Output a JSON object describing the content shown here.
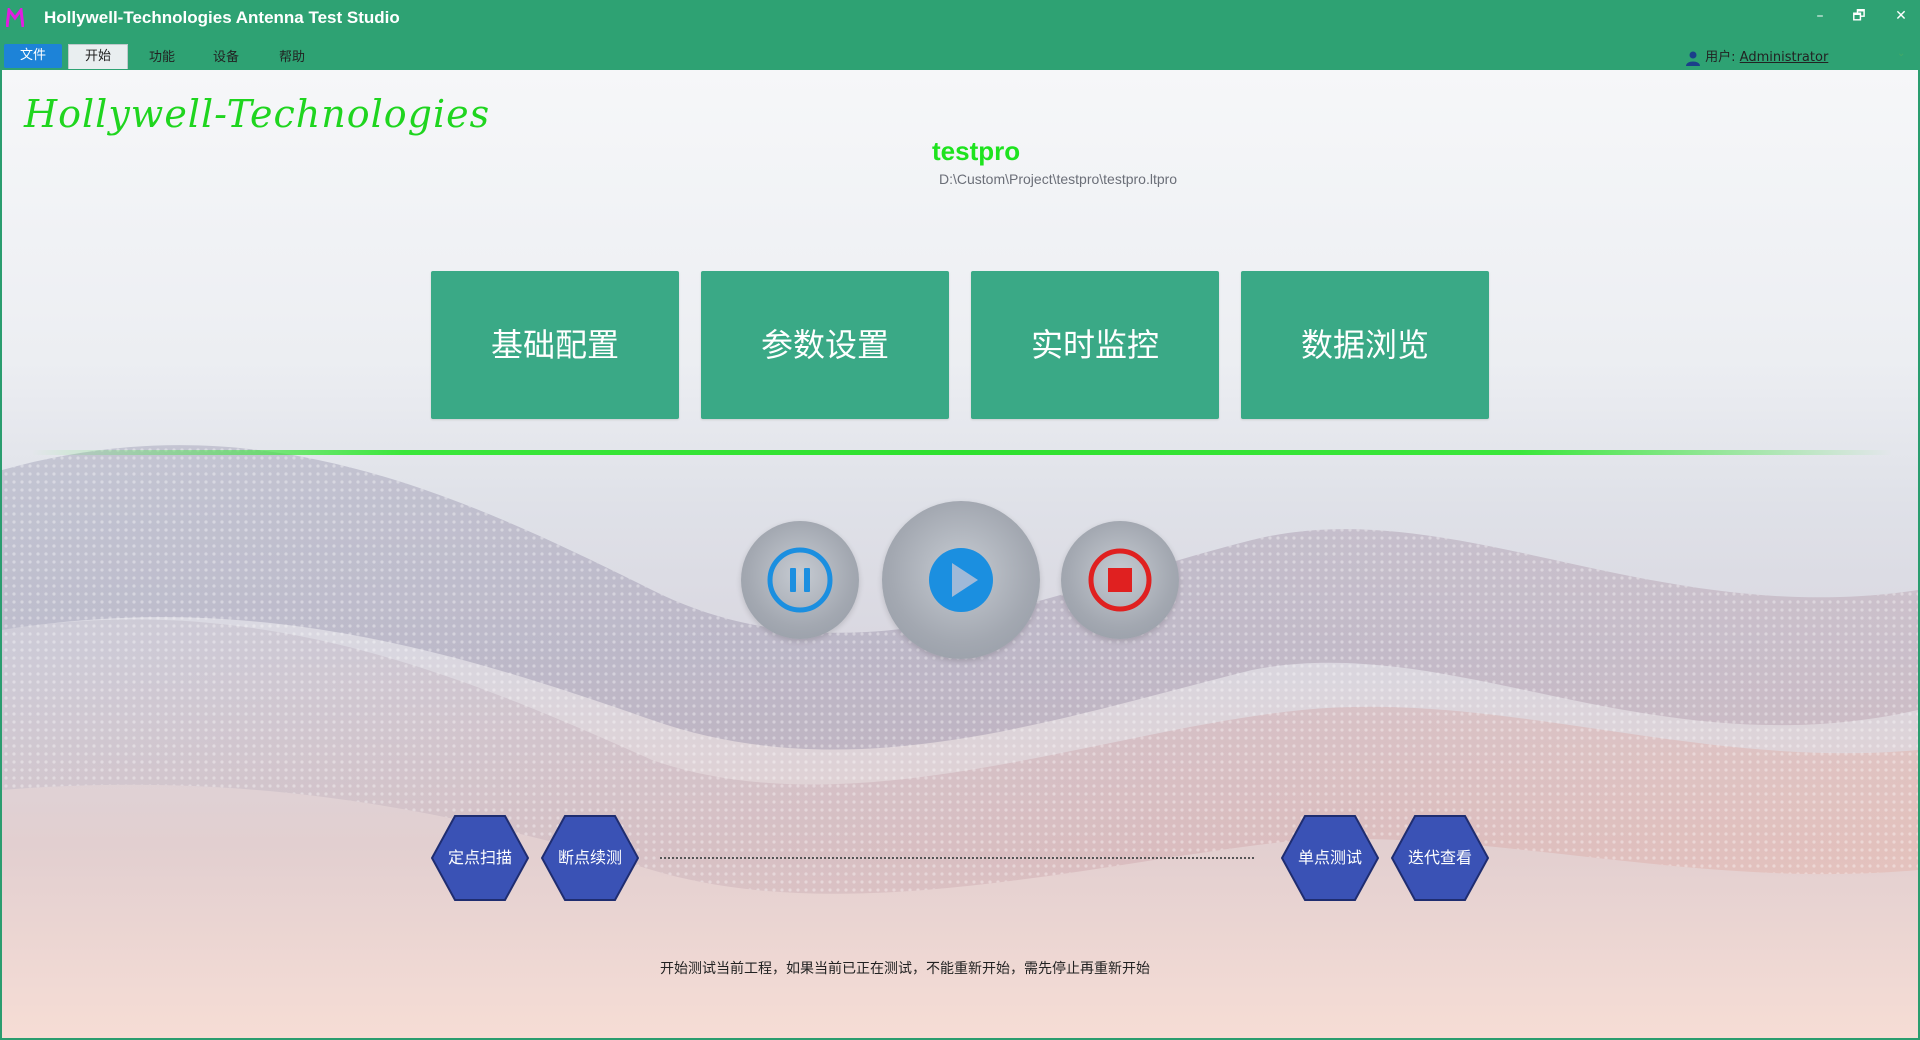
{
  "window": {
    "title": "Hollywell-Technologies Antenna Test Studio",
    "controls": {
      "minimize": "–",
      "maximize": "🗗",
      "close": "✕"
    }
  },
  "menubar": {
    "items": [
      "文件",
      "开始",
      "功能",
      "设备",
      "帮助"
    ],
    "active": "开始",
    "user_label": "用户:",
    "user_name": "Administrator",
    "collapse_glyph": "⌄"
  },
  "main": {
    "brand": "Hollywell-Technologies",
    "project_name": "testpro",
    "project_path": "D:\\Custom\\Project\\testpro\\testpro.ltpro",
    "tiles": [
      "基础配置",
      "参数设置",
      "实时监控",
      "数据浏览"
    ],
    "controls": {
      "pause": "pause-icon",
      "play": "play-icon",
      "stop": "stop-icon"
    },
    "modes": [
      "定点扫描",
      "断点续测",
      "单点测试",
      "迭代查看"
    ],
    "hint": "开始测试当前工程，如果当前已正在测试，不能重新开始，需先停止再重新开始"
  },
  "colors": {
    "title_bar": "#2ea273",
    "tile": "#3aa986",
    "accent_green": "#1ee31e",
    "hex_fill": "#3a52b5",
    "ctrl_blue": "#1b8fe0",
    "stop_red": "#e02020"
  }
}
